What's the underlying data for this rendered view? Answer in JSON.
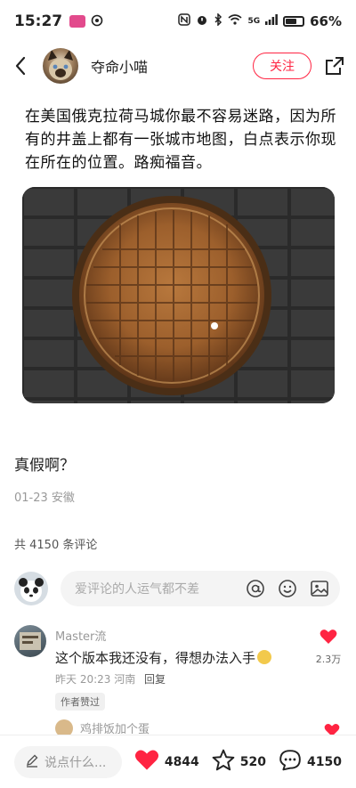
{
  "status_bar": {
    "time": "15:27",
    "network": "5G",
    "battery": "66%",
    "battery_level": 0.66
  },
  "author": {
    "name": "夺命小喵",
    "follow_label": "关注"
  },
  "post": {
    "caption": "在美国俄克拉荷马城你最不容易迷路，因为所有的井盖上都有一张城市地图，白点表示你现在所在的位置。路痴福音。",
    "title": "真假啊？",
    "meta": "01-23 安徽",
    "comment_count": "共 4150 条评论"
  },
  "comment_input": {
    "placeholder": "爱评论的人运气都不差"
  },
  "comments": [
    {
      "user": "Master流",
      "text": "这个版本我还没有，得想办法入手",
      "time_location": "昨天 20:23 河南",
      "reply_label": "回复",
      "badge": "作者赞过",
      "likes": "2.3万"
    }
  ],
  "subreply": {
    "user": "鸡排饭加个蛋"
  },
  "bottom_bar": {
    "input_placeholder": "说点什么...",
    "likes": "4844",
    "favorites": "520",
    "comments": "4150"
  },
  "colors": {
    "accent": "#ff2442",
    "status_app_icon": "#e24a8c"
  },
  "icons": [
    "back-icon",
    "share-icon",
    "at-icon",
    "emoji-icon",
    "image-icon",
    "heart-icon",
    "star-icon",
    "comment-icon",
    "pencil-icon"
  ]
}
